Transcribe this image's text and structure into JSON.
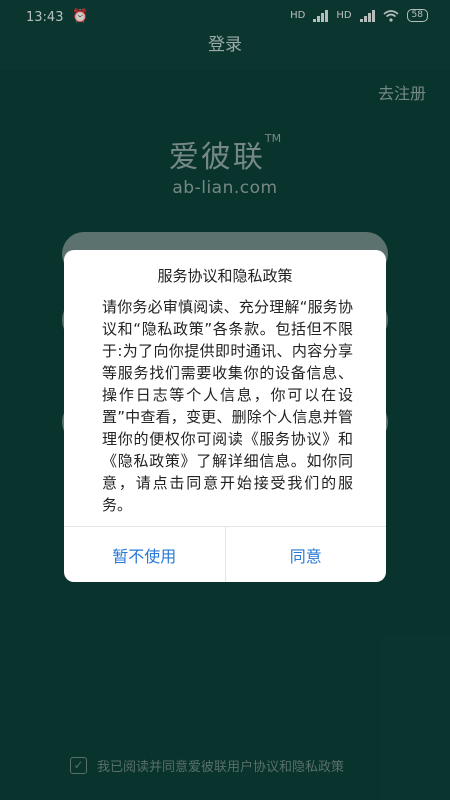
{
  "status_bar": {
    "time": "13:43",
    "alarm_icon": "alarm-icon",
    "network_labels": [
      "HD",
      "HD"
    ],
    "battery": "58"
  },
  "titlebar": {
    "title": "登录"
  },
  "go_register": "去注册",
  "logo": {
    "cn": "爱彼联",
    "tm": "TM",
    "url": "ab-lian.com"
  },
  "agree_text": "我已阅读并同意爱彼联用户协议和隐私政策",
  "dialog": {
    "title": "服务协议和隐私政策",
    "body": "请你务必审慎阅读、充分理解“服务协议和“隐私政策”各条款。包括但不限于:为了向你提供即时通讯、内容分享等服务找们需要收集你的设备信息、操作日志等个人信息，你可以在设置”中查看，变更、删除个人信息并管理你的便权你可阅读《服务协议》和《隐私政策》了解详细信息。如你同意，请点击同意开始接受我们的服务。",
    "cancel_label": "暂不使用",
    "ok_label": "同意"
  },
  "colors": {
    "background": "#0c3f38",
    "dialog_button": "#2a79d6"
  }
}
